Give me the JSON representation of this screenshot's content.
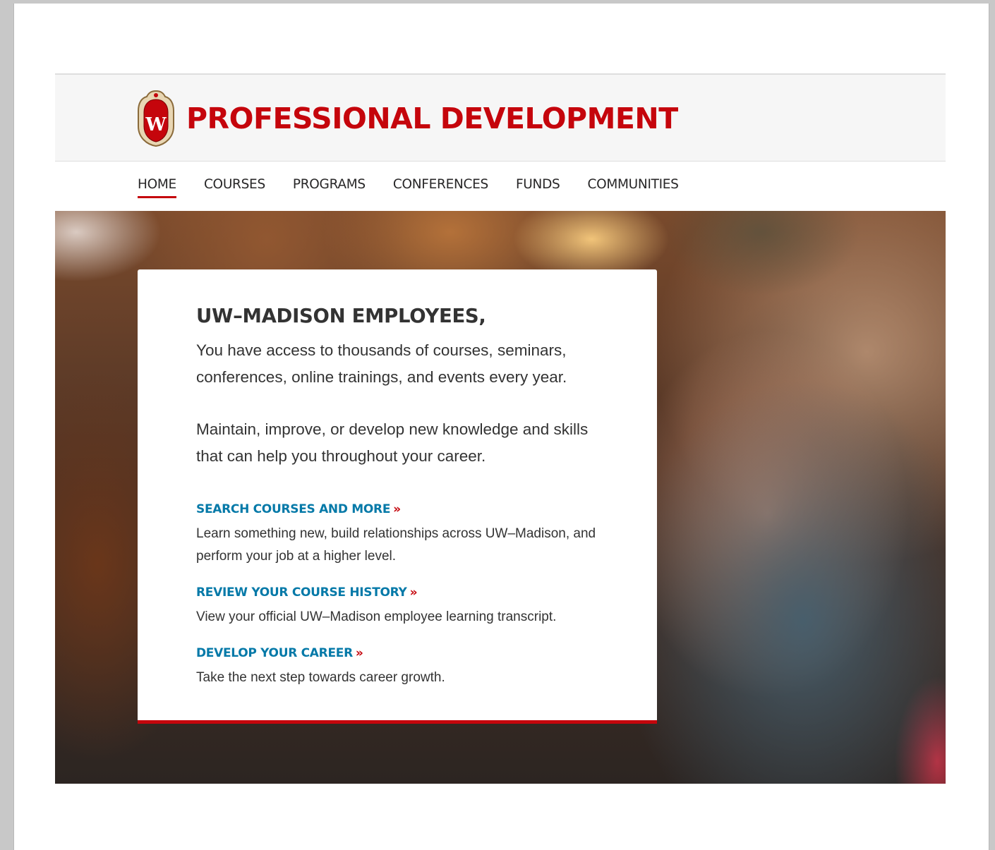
{
  "header": {
    "title": "PROFESSIONAL DEVELOPMENT",
    "crest_icon": "uw-crest-icon",
    "crest_letter": "W"
  },
  "nav": {
    "items": [
      {
        "label": "HOME",
        "active": true
      },
      {
        "label": "COURSES",
        "active": false
      },
      {
        "label": "PROGRAMS",
        "active": false
      },
      {
        "label": "CONFERENCES",
        "active": false
      },
      {
        "label": "FUNDS",
        "active": false
      },
      {
        "label": "COMMUNITIES",
        "active": false
      }
    ]
  },
  "card": {
    "heading": "UW–MADISON EMPLOYEES,",
    "intro": [
      "You have access to thousands of courses, seminars, conferences, online trainings, and events every year.",
      "Maintain, improve, or develop new knowledge and skills that can help you throughout your career."
    ],
    "links": [
      {
        "title": "SEARCH COURSES AND MORE",
        "chevron": "»",
        "description": "Learn something new, build relationships across UW–Madison, and perform your job at a higher level."
      },
      {
        "title": "REVIEW YOUR COURSE HISTORY",
        "chevron": "»",
        "description": "View your official UW–Madison employee learning transcript."
      },
      {
        "title": "DEVELOP YOUR CAREER",
        "chevron": "»",
        "description": "Take the next step towards career growth."
      }
    ]
  },
  "colors": {
    "brand_red": "#c5050c",
    "link_blue": "#0479a8",
    "text": "#333333",
    "header_bg": "#f6f6f6"
  }
}
